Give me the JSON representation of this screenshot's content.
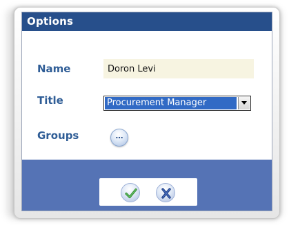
{
  "dialog": {
    "title": "Options"
  },
  "form": {
    "name_label": "Name",
    "name_value": "Doron Levi",
    "title_label": "Title",
    "title_value": "Procurement Manager",
    "groups_label": "Groups",
    "groups_button_text": "…"
  },
  "colors": {
    "title_bar": "#274f8b",
    "label_text": "#2f5d96",
    "footer": "#5573b5",
    "selected_bg": "#316ac5"
  },
  "icons": {
    "ok": "checkmark-icon",
    "cancel": "x-icon"
  }
}
